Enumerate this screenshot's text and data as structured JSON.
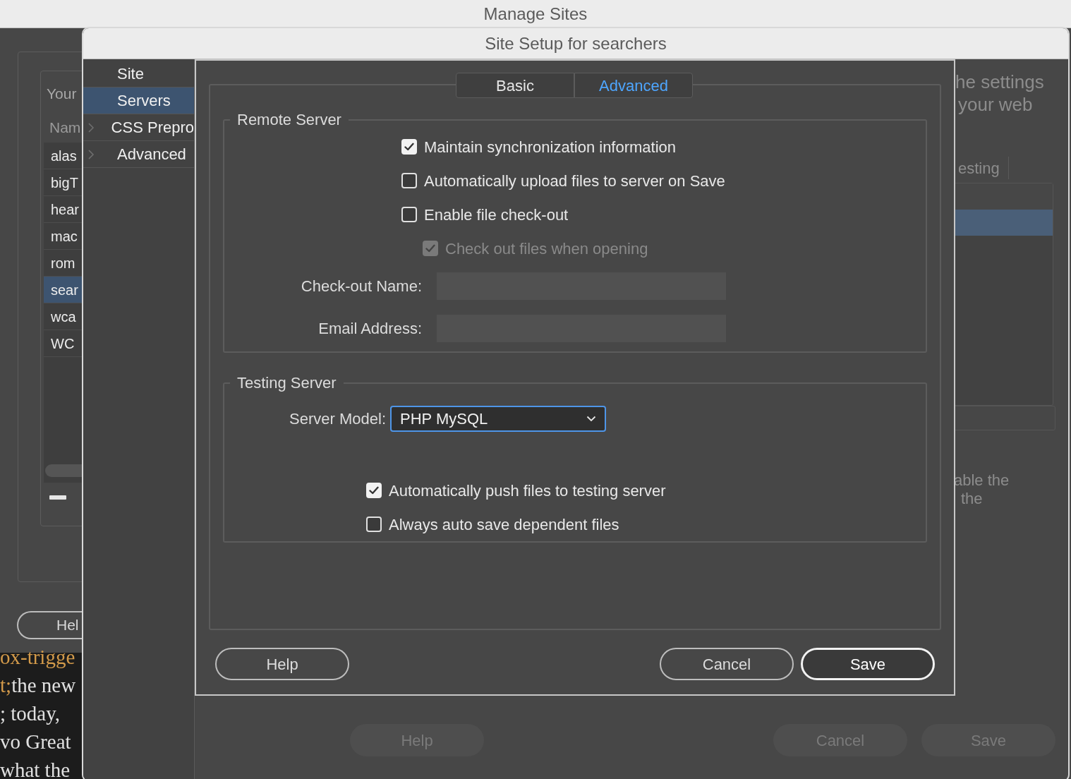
{
  "screen_title": "Manage Sites",
  "manage_sites": {
    "heading": "Your",
    "column_header": "Nam",
    "sites": [
      {
        "name": "alas",
        "selected": false
      },
      {
        "name": "bigT",
        "selected": false
      },
      {
        "name": "hear",
        "selected": false
      },
      {
        "name": "mac",
        "selected": false
      },
      {
        "name": "rom",
        "selected": false
      },
      {
        "name": "sear",
        "selected": true
      },
      {
        "name": "wca",
        "selected": false
      },
      {
        "name": "WC",
        "selected": false
      }
    ],
    "help_button": "Hel"
  },
  "background_text": [
    {
      "segments": [
        {
          "text": "ox-trigge",
          "kind": "code"
        }
      ]
    },
    {
      "segments": [
        {
          "text": "t;",
          "kind": "code"
        },
        {
          "text": "the new",
          "kind": "plain"
        }
      ]
    },
    {
      "segments": [
        {
          "text": "; today,",
          "kind": "plain"
        }
      ]
    },
    {
      "segments": [
        {
          "text": "vo Great",
          "kind": "plain"
        }
      ]
    },
    {
      "segments": [
        {
          "text": "what the",
          "kind": "plain"
        }
      ]
    }
  ],
  "site_setup": {
    "title": "Site Setup for searchers",
    "categories": [
      {
        "label": "Site",
        "selected": false,
        "expandable": false
      },
      {
        "label": "Servers",
        "selected": true,
        "expandable": false
      },
      {
        "label": "CSS Prepro",
        "selected": false,
        "expandable": true
      },
      {
        "label": "Advanced",
        "selected": false,
        "expandable": true
      }
    ],
    "description": [
      "he settings",
      "your web"
    ],
    "column_header": "esting",
    "server_rows": [
      {
        "selected": false
      },
      {
        "selected": true
      }
    ],
    "note": [
      "able the",
      "the"
    ],
    "buttons": [
      {
        "label": "Help",
        "disabled": true
      },
      {
        "label": "Cancel",
        "disabled": true
      },
      {
        "label": "Save",
        "disabled": true
      }
    ]
  },
  "server_dialog": {
    "tabs": [
      {
        "label": "Basic",
        "selected": false
      },
      {
        "label": "Advanced",
        "selected": true
      }
    ],
    "remote_server": {
      "legend": "Remote Server",
      "options": [
        {
          "label": "Maintain synchronization information",
          "checked": true,
          "disabled": false
        },
        {
          "label": "Automatically upload files to server on Save",
          "checked": false,
          "disabled": false
        },
        {
          "label": "Enable file check-out",
          "checked": false,
          "disabled": false,
          "children": [
            {
              "label": "Check out files when opening",
              "checked": true,
              "disabled": true
            }
          ]
        }
      ],
      "fields": [
        {
          "label": "Check-out Name:"
        },
        {
          "label": "Email Address:"
        }
      ]
    },
    "testing_server": {
      "legend": "Testing Server",
      "server_model": {
        "label": "Server Model:",
        "value": "PHP MySQL"
      },
      "options": [
        {
          "label": "Automatically push files to testing server",
          "checked": true,
          "disabled": false
        },
        {
          "label": "Always auto save dependent files",
          "checked": false,
          "disabled": false
        }
      ]
    },
    "buttons": [
      {
        "label": "Help",
        "kind": "default"
      },
      {
        "label": "Cancel",
        "kind": "default"
      },
      {
        "label": "Save",
        "kind": "primary"
      }
    ]
  }
}
